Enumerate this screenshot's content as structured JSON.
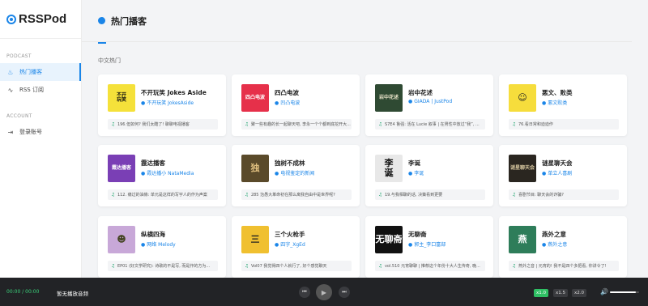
{
  "app": {
    "logo": "RSSPod"
  },
  "sidebar": {
    "section_podcast": "PODCAST",
    "section_account": "ACCOUNT",
    "items": [
      {
        "label": "热门播客",
        "icon": "flame-icon"
      },
      {
        "label": "RSS 订阅",
        "icon": "rss-icon"
      },
      {
        "label": "登录账号",
        "icon": "login-icon"
      }
    ]
  },
  "header": {
    "title": "热门播客"
  },
  "group": {
    "label": "中文热门"
  },
  "podcasts": [
    {
      "title": "不开玩笑 Jokes Aside",
      "author": "不开玩笑 JokesAside",
      "latest": "196.但如何? 我们太酷了! 聊聊电视播客",
      "cover_bg": "#f5e13a",
      "cover_text": "不开\n玩笑",
      "cover_fg": "#111"
    },
    {
      "title": "四凸电波",
      "author": "凹凸电波",
      "latest": "聚一些有趣的长一起聊天吧, 李永一个个都到底挖开大...",
      "cover_bg": "#e6304a",
      "cover_text": "四凸电波",
      "cover_fg": "#fff"
    },
    {
      "title": "岩中花述",
      "author": "GIADA | JustPod",
      "latest": "S7E4 鲁强: 活在 Lucie 叙事 | 在男性中放过“我”, ...",
      "cover_bg": "#2f4a33",
      "cover_text": "岩中花述",
      "cover_fg": "#e8e3c8"
    },
    {
      "title": "悪文、败类",
      "author": "悪文败类",
      "latest": "76.看日常和迪迪作",
      "cover_bg": "#f6dd3c",
      "cover_text": "☺",
      "cover_fg": "#222"
    },
    {
      "title": "霞达播客",
      "author": "霞达播小 NataMedia",
      "latest": "112. 痛过的油條: 单元是这样的写宇人的作为声案",
      "cover_bg": "#7a3fb5",
      "cover_text": "霞达播客",
      "cover_fg": "#fff"
    },
    {
      "title": "独树不成林",
      "author": "电视鉴定的新闻",
      "latest": "285 治愚大革命初在那么离我自由中是世界呢?",
      "cover_bg": "#5a4a2a",
      "cover_text": "独",
      "cover_fg": "#e0c080"
    },
    {
      "title": "李诞",
      "author": "李诞",
      "latest": "19.与我相聊的话, 决策看到更要",
      "cover_bg": "#e8e8e8",
      "cover_text": "李\n诞",
      "cover_fg": "#111"
    },
    {
      "title": "谜星聊天会",
      "author": "单立人喜剧",
      "latest": "喜剧节目: 聊天会的诈骗?",
      "cover_bg": "#2a2620",
      "cover_text": "谜星聊天会",
      "cover_fg": "#d8c8a0"
    },
    {
      "title": "纵横四海",
      "author": "网络 Melody",
      "latest": "EP01 (好文学研究): 诗歌的不是写, 而是作的方为...",
      "cover_bg": "#c8a8d8",
      "cover_text": "☻",
      "cover_fg": "#442"
    },
    {
      "title": "三个火枪手",
      "author": "四字_XgEd",
      "latest": "Vol07 我觉得四个人就行了, 好个感觉聊天",
      "cover_bg": "#f0c030",
      "cover_text": "三",
      "cover_fg": "#222"
    },
    {
      "title": "无聊斋",
      "author": "郭主_李口富部",
      "latest": "vol.510 元宵聊聊 | 推荐这个年份十大人生传奇, 晚...",
      "cover_bg": "#111111",
      "cover_text": "无聊斋",
      "cover_fg": "#fff"
    },
    {
      "title": "燕外之意",
      "author": "燕外之意",
      "latest": "燕外之音 | 元宵的! 我不是四个多把看, 你讲令了!",
      "cover_bg": "#2e7d5a",
      "cover_text": "燕",
      "cover_fg": "#fff"
    }
  ],
  "player": {
    "time": "00:00 / 00:00",
    "now_playing": "暂无播放音频",
    "speeds": [
      "x1.0",
      "x1.5",
      "x2.0"
    ],
    "active_speed": "x1.0",
    "volume": 0.9
  }
}
